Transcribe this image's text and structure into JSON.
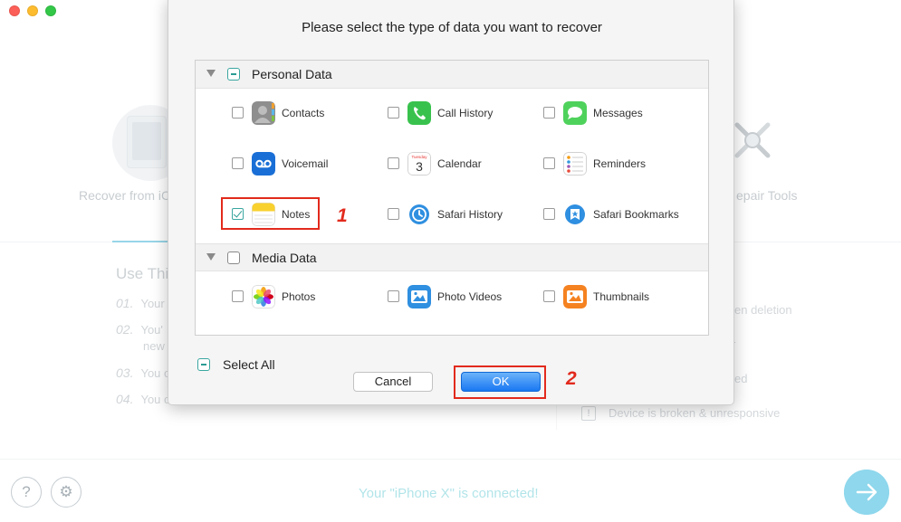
{
  "window": {
    "traffic_lights": [
      "close",
      "minimize",
      "zoom"
    ]
  },
  "background": {
    "mode_left_label": "Recover from iC",
    "mode_right_label": "epair Tools",
    "use_title": "Use Thi",
    "steps": [
      {
        "num": "01.",
        "text": "Your"
      },
      {
        "num": "02.",
        "text": "You'"
      },
      {
        "num": "03.",
        "text": "You c"
      },
      {
        "num": "04.",
        "text": "You c"
      }
    ],
    "step2_cont": "new",
    "right_texts": [
      "en deletion",
      "r",
      "ed"
    ],
    "right_last": "Device is broken & unresponsive",
    "excl_icon": "!",
    "status": "Your \"iPhone X\" is connected!",
    "help_icon": "?",
    "gear_icon": "⚙",
    "next_icon": "→"
  },
  "dialog": {
    "title": "Please select the type of data you want to recover",
    "sections": [
      {
        "label": "Personal Data",
        "state": "mixed",
        "items": [
          {
            "label": "Contacts",
            "icon": "contacts-icon",
            "checked": false
          },
          {
            "label": "Call History",
            "icon": "phone-icon",
            "checked": false
          },
          {
            "label": "Messages",
            "icon": "messages-icon",
            "checked": false
          },
          {
            "label": "Voicemail",
            "icon": "voicemail-icon",
            "checked": false
          },
          {
            "label": "Calendar",
            "icon": "calendar-icon",
            "checked": false,
            "icon_day": "Tuesday",
            "icon_date": "3"
          },
          {
            "label": "Reminders",
            "icon": "reminders-icon",
            "checked": false
          },
          {
            "label": "Notes",
            "icon": "notes-icon",
            "checked": true
          },
          {
            "label": "Safari History",
            "icon": "safari-history-icon",
            "checked": false
          },
          {
            "label": "Safari Bookmarks",
            "icon": "safari-bookmarks-icon",
            "checked": false
          }
        ]
      },
      {
        "label": "Media Data",
        "state": "unchecked",
        "items": [
          {
            "label": "Photos",
            "icon": "photos-icon",
            "checked": false
          },
          {
            "label": "Photo Videos",
            "icon": "photo-videos-icon",
            "checked": false
          },
          {
            "label": "Thumbnails",
            "icon": "thumbnails-icon",
            "checked": false
          }
        ]
      }
    ],
    "select_all_label": "Select All",
    "cancel_label": "Cancel",
    "ok_label": "OK"
  },
  "annotations": {
    "step1": "1",
    "step2": "2",
    "color": "#e22a1d"
  },
  "colors": {
    "accent": "#43b3d6",
    "ok_button": "#1978f2",
    "status_text": "#73cfd8"
  }
}
